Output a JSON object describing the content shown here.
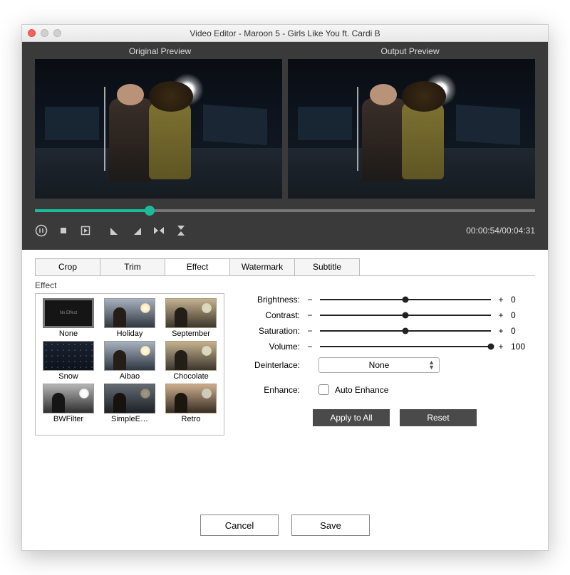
{
  "title": "Video Editor - Maroon 5 - Girls Like You ft. Cardi B",
  "previews": {
    "original": "Original Preview",
    "output": "Output Preview"
  },
  "time": {
    "current": "00:00:54",
    "total": "00:04:31"
  },
  "tabs": [
    "Crop",
    "Trim",
    "Effect",
    "Watermark",
    "Subtitle"
  ],
  "activeTab": "Effect",
  "section_label": "Effect",
  "effects": [
    {
      "name": "None",
      "selected": true
    },
    {
      "name": "Holiday"
    },
    {
      "name": "September"
    },
    {
      "name": "Snow"
    },
    {
      "name": "Aibao"
    },
    {
      "name": "Chocolate"
    },
    {
      "name": "BWFilter"
    },
    {
      "name": "SimpleE…"
    },
    {
      "name": "Retro"
    }
  ],
  "sliders": {
    "brightness": {
      "label": "Brightness:",
      "value": "0",
      "pos": 50
    },
    "contrast": {
      "label": "Contrast:",
      "value": "0",
      "pos": 50
    },
    "saturation": {
      "label": "Saturation:",
      "value": "0",
      "pos": 50
    },
    "volume": {
      "label": "Volume:",
      "value": "100",
      "pos": 100
    }
  },
  "deinterlace": {
    "label": "Deinterlace:",
    "selected": "None"
  },
  "enhance": {
    "label": "Enhance:",
    "checkbox_label": "Auto Enhance"
  },
  "buttons": {
    "apply_all": "Apply to All",
    "reset": "Reset",
    "cancel": "Cancel",
    "save": "Save"
  },
  "glyphs": {
    "minus": "−",
    "plus": "+"
  },
  "timeline": {
    "progress_pct": 23
  }
}
